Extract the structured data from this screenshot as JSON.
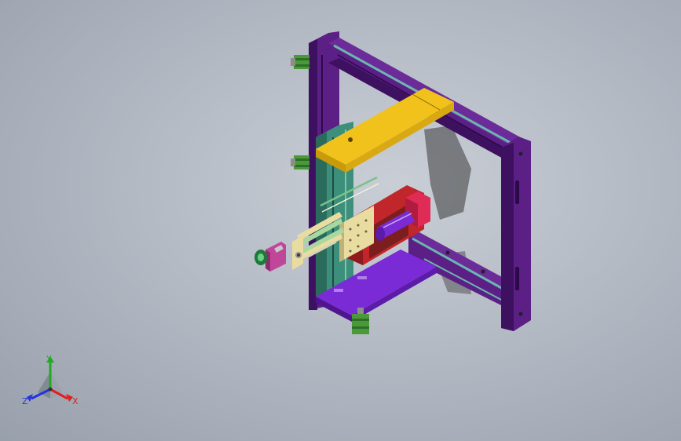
{
  "triad": {
    "x_label": "X",
    "y_label": "Y",
    "z_label": "Z",
    "x_color": "#e02020",
    "y_color": "#22aa22",
    "z_color": "#2233dd"
  },
  "colors": {
    "frame": "#5b1f86",
    "frame_dark": "#3d1160",
    "yellow_plate": "#f2c21c",
    "motor": "#4a9a3a",
    "red_block": "#c0262a",
    "pink": "#e02b57",
    "cream": "#e8dca0",
    "rail": "#6bb6b0",
    "shadow": "#2a2a2a"
  }
}
